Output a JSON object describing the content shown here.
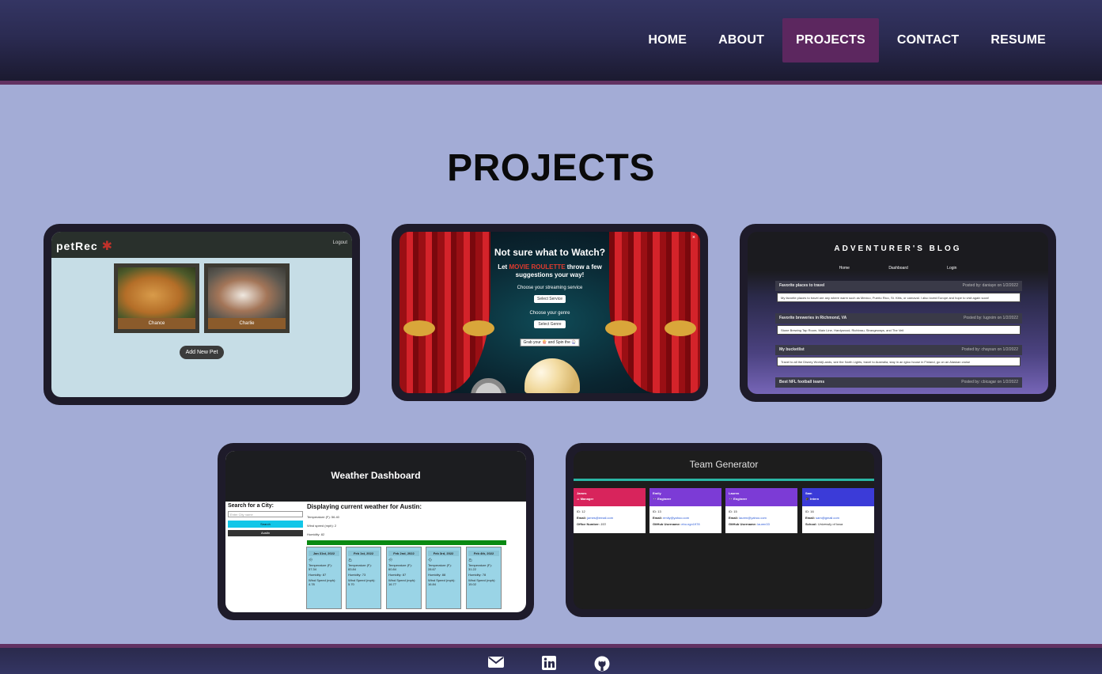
{
  "nav": {
    "items": [
      "HOME",
      "ABOUT",
      "PROJECTS",
      "CONTACT",
      "RESUME"
    ],
    "active": "PROJECTS"
  },
  "page_title": "PROJECTS",
  "colors": {
    "background": "#a3acd6",
    "header": "#343563",
    "accent": "#5c275f",
    "card": "#1e1b2a"
  },
  "projects": {
    "petrec": {
      "logo": "petRec",
      "logout": "Logout",
      "pets": [
        "Chance",
        "Charlie"
      ],
      "add_button": "Add New Pet"
    },
    "movie": {
      "title": "Not sure what to Watch?",
      "subtitle_pre": "Let ",
      "subtitle_brand": "MOVIE ROULETTE",
      "subtitle_post": " throw a few suggestions your way!",
      "service_label": "Choose your streaming service",
      "service_select": "Select Service",
      "genre_label": "Choose your genre",
      "genre_select": "Select Genre",
      "grab_label": "Grab your 🍿 and Spin the 🎡",
      "close": "×"
    },
    "blog": {
      "title": "ADVENTURER'S BLOG",
      "nav": [
        "Home",
        "Dashboard",
        "Login"
      ],
      "posts": [
        {
          "title": "Favorite places to travel",
          "meta": "Posted by: daniaye on 1/2/2022",
          "body": "My favorite places to travel are any where warm such as Mexico, Puerto Rico, St. Kitts, or carnaval. I also loved Europe and hope to visit again soon!"
        },
        {
          "title": "Favorite breweries in Richmond, VA",
          "meta": "Posted by: lugrxim on 1/2/2022",
          "body": "Stone Brewing Tap Room, Main Line, Hardywood, Richbrau, Strangeways, and The Veil"
        },
        {
          "title": "My bucketlist",
          "meta": "Posted by: chaysun on 1/2/2022",
          "body": "Travel to all the Disney World(Lands, see the North Lights, travel to Australia, stay in an igloo house in Finland, go on an Alaskan cruise"
        },
        {
          "title": "Best NFL football teams",
          "meta": "Posted by: cbicagar on 1/2/2022",
          "body": ""
        }
      ]
    },
    "weather": {
      "title": "Weather Dashboard",
      "search_label": "Search for a City:",
      "search_placeholder": "Enter City name",
      "search_button": "Search",
      "history_item": "Austin",
      "current_heading": "Displaying current weather for Austin:",
      "temperature": "Temperature (F): 56.40",
      "wind": "Wind speed (mph): 2",
      "humidity": "Humidity: 82",
      "forecast": [
        {
          "date": "Jan 31st, 2022",
          "temp": "Temperature (F): 57.34",
          "hum": "Humidity: 87",
          "wind": "Wind Speed (mph): 4.78"
        },
        {
          "date": "Feb 1st, 2022",
          "temp": "Temperature (F): 83.84",
          "hum": "Humidity: 73",
          "wind": "Wind Speed (mph): 5.70"
        },
        {
          "date": "Feb 2nd, 2022",
          "temp": "Temperature (F): 60.84",
          "hum": "Humidity: 87",
          "wind": "Wind Speed (mph): 16.77"
        },
        {
          "date": "Feb 3rd, 2022",
          "temp": "Temperature (F): 28.67",
          "hum": "Humidity: 88",
          "wind": "Wind Speed (mph): 16.84"
        },
        {
          "date": "Feb 4th, 2022",
          "temp": "Temperature (F): 31.22",
          "hum": "Humidity: 78",
          "wind": "Wind Speed (mph): 15.02"
        }
      ]
    },
    "team": {
      "title": "Team Generator",
      "members": [
        {
          "name": "James",
          "role": "☕ Manager",
          "color": "#d8245c",
          "id": "ID: 12",
          "email_label": "Email:",
          "email": "james@email.com",
          "extra_label": "Office Number:",
          "extra": "153"
        },
        {
          "name": "Emily",
          "role": "👓 Engineer",
          "color": "#7c3bd6",
          "id": "ID: 13",
          "email_label": "Email:",
          "email": "emily@yahoo.com",
          "extra_label": "GitHub Username:",
          "extra": "ebo.ngn1978"
        },
        {
          "name": "Lauren",
          "role": "👓 Engineer",
          "color": "#7c3bd6",
          "id": "ID: 15",
          "email_label": "Email:",
          "email": "lauren@yahoo.com",
          "extra_label": "GitHub Username:",
          "extra": "lauren33"
        },
        {
          "name": "Sam",
          "role": "🎓 Intern",
          "color": "#3b3bd8",
          "id": "ID: 16",
          "email_label": "Email:",
          "email": "sam@gmail.com",
          "extra_label": "School:",
          "extra": "University of Iowa"
        }
      ]
    }
  },
  "footer": {
    "icons": [
      "envelope-icon",
      "linkedin-icon",
      "github-icon"
    ]
  }
}
